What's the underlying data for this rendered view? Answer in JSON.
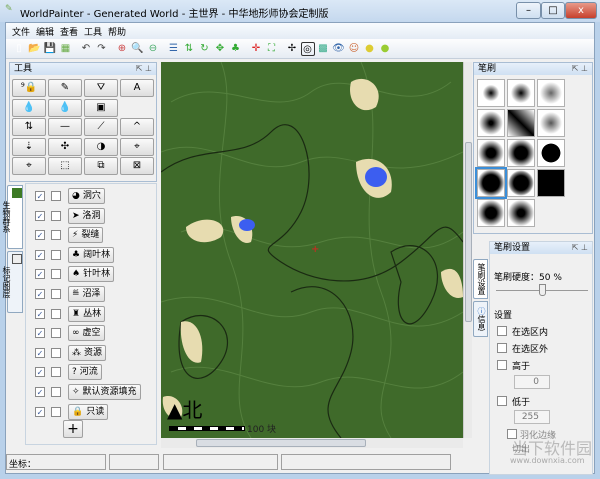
{
  "window": {
    "title": "WorldPainter - Generated World - 主世界 - 中华地形师协会定制版",
    "minimize": "–",
    "maximize": "□",
    "close": "x"
  },
  "menu": [
    "文件",
    "编辑",
    "查看",
    "工具",
    "帮助"
  ],
  "toolbar_icons": [
    "new-icon",
    "open-icon",
    "save-icon",
    "export-icon",
    "undo-icon",
    "redo-icon",
    "zoom-in-icon",
    "zoom-reset-icon",
    "zoom-out-icon",
    "grid-icon",
    "contours-icon",
    "rotate-icon",
    "move-icon",
    "biome-icon",
    "center-icon",
    "fit-icon",
    "crosshair-icon",
    "target-icon",
    "image-icon",
    "eye-icon",
    "user-icon",
    "light-icon",
    "light2-icon"
  ],
  "tools": {
    "title": "工具",
    "buttons": [
      "⁹🔒",
      "✎",
      "⛛",
      "A",
      "💧",
      "💧",
      "▣",
      "⇅",
      "—",
      "⟋",
      "^",
      "⇣",
      "✣",
      "◑",
      "⌖",
      "⌖",
      "⬚",
      "⧉",
      "⊠"
    ]
  },
  "left_tabs": [
    "生物群系",
    "标记图层"
  ],
  "layers": [
    {
      "label": "洞穴",
      "icon": "◕",
      "visible": true,
      "solo": false
    },
    {
      "label": "洛洞",
      "icon": "➤",
      "visible": true,
      "solo": false
    },
    {
      "label": "裂缝",
      "icon": "⚡",
      "visible": true,
      "solo": false
    },
    {
      "label": "阔叶林",
      "icon": "♣",
      "visible": true,
      "solo": false
    },
    {
      "label": "针叶林",
      "icon": "♠",
      "visible": true,
      "solo": false
    },
    {
      "label": "沼泽",
      "icon": "≝",
      "visible": true,
      "solo": false
    },
    {
      "label": "丛林",
      "icon": "♜",
      "visible": true,
      "solo": false
    },
    {
      "label": "虚空",
      "icon": "∞",
      "visible": true,
      "solo": false
    },
    {
      "label": "资源",
      "icon": "⁂",
      "visible": true,
      "solo": false
    },
    {
      "label": "河流",
      "icon": "?",
      "visible": true,
      "solo": false
    },
    {
      "label": "默认资源填充",
      "icon": "✧",
      "visible": true,
      "solo": false
    },
    {
      "label": "只读",
      "icon": "🔒",
      "visible": true,
      "solo": false
    }
  ],
  "add_layer": "+",
  "map": {
    "north_label": "北",
    "scale_label": "100 块",
    "terrain_color": "#3f6a2a",
    "water_color": "#3c5ef0",
    "sand_color": "#e7dcb0"
  },
  "brush_panel": {
    "title": "笔刷"
  },
  "brush_settings": {
    "title": "笔刷设置",
    "hardness_label": "笔刷硬度：50 %",
    "hardness": 50,
    "settings_label": "设置",
    "inside_selection": "在选区内",
    "outside_selection": "在选区外",
    "above": "高于",
    "above_value": "0",
    "below": "低于",
    "below_value": "255",
    "feather": "羽化边缘",
    "cut": "切出"
  },
  "right_tabs": [
    "笔刷设置",
    "信息"
  ],
  "status": {
    "coords_label": "坐标："
  },
  "watermark": {
    "text": "当下软件园",
    "url": "www.downxia.com"
  }
}
